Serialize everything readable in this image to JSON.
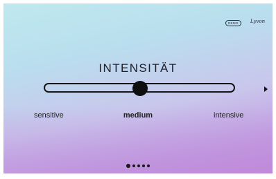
{
  "header": {
    "badge_label": "DEMO",
    "brand_logo_text": "Lyvon"
  },
  "main": {
    "title": "INTENSITÄT",
    "slider": {
      "level_labels": [
        "sensitive",
        "medium",
        "intensive"
      ],
      "selected_index": 1,
      "value_fraction": 0.5
    }
  },
  "pagination": {
    "pages": 5,
    "current": 1
  },
  "icons": {
    "next": "play-right-icon"
  },
  "colors": {
    "ink": "#141414",
    "bg_top": "#bfe8ef",
    "bg_bottom": "#c08ada"
  }
}
